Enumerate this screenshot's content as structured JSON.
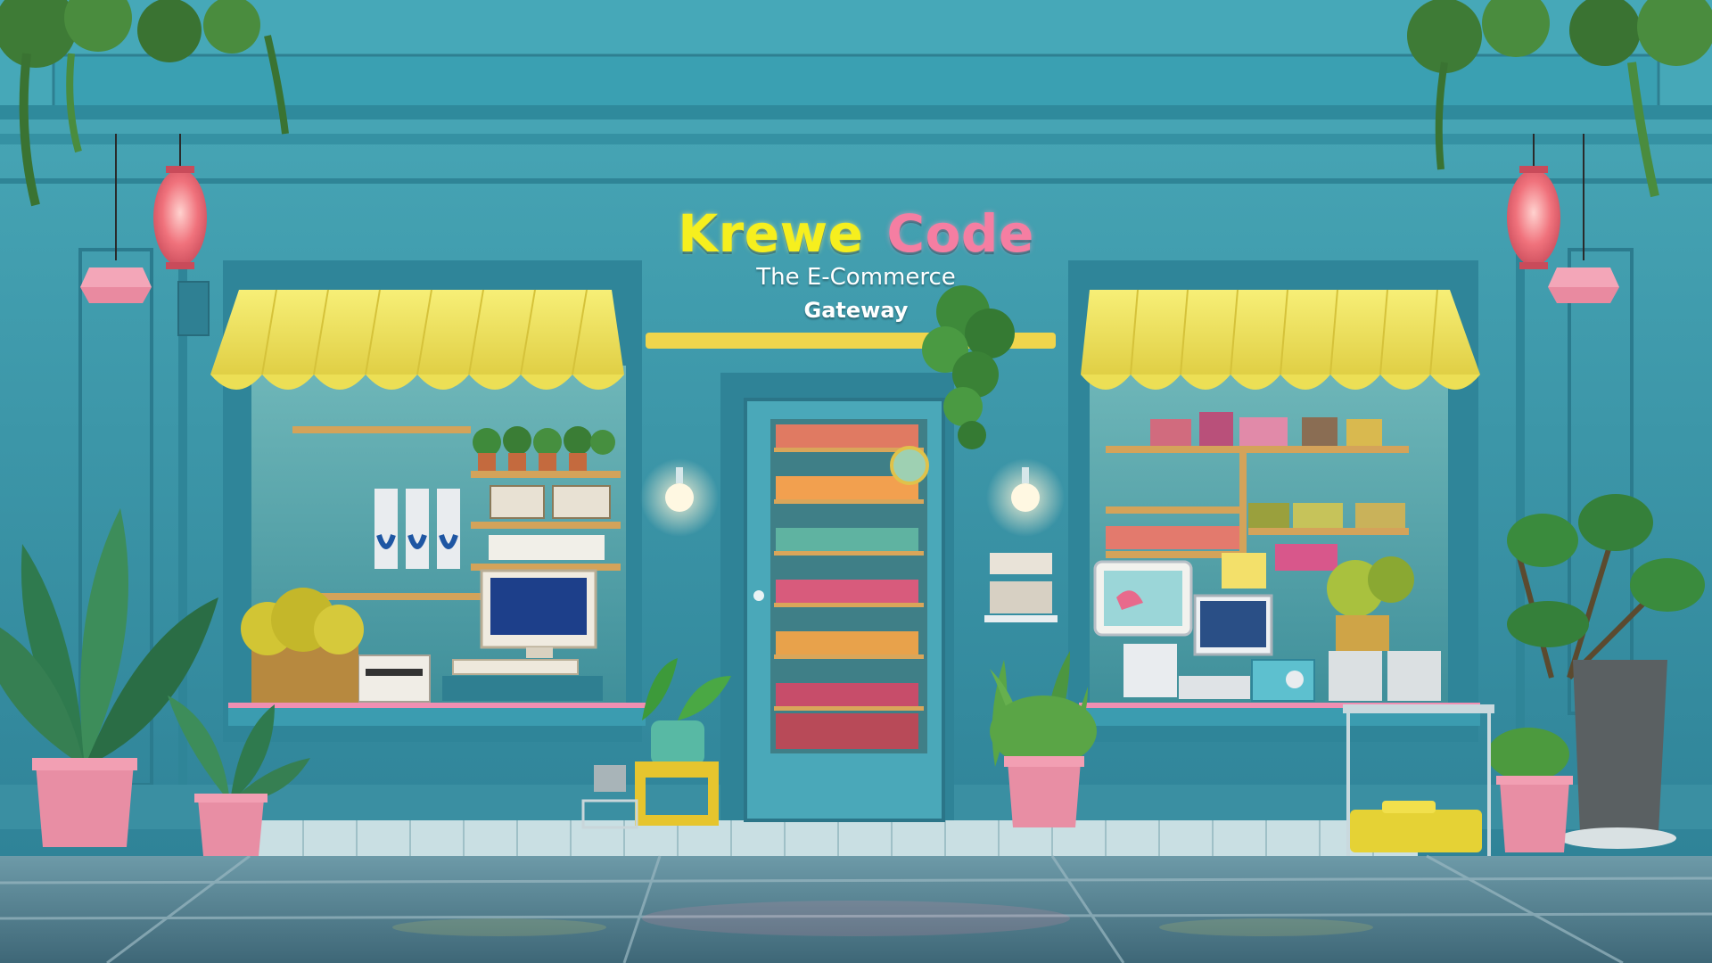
{
  "storefront": {
    "sign": {
      "brand_word_1": "Krewe",
      "brand_word_2": "Code",
      "tagline_line_1": "The E-Commerce",
      "tagline_line_2": "Gateway"
    }
  },
  "colors": {
    "wall": "#3d97aa",
    "awning": "#f1e55c",
    "brand_yellow": "#f6ef1e",
    "brand_pink": "#f57ea2",
    "lantern": "#f0727c",
    "pot": "#e88ea4",
    "sidewalk": "#5e8a99"
  }
}
